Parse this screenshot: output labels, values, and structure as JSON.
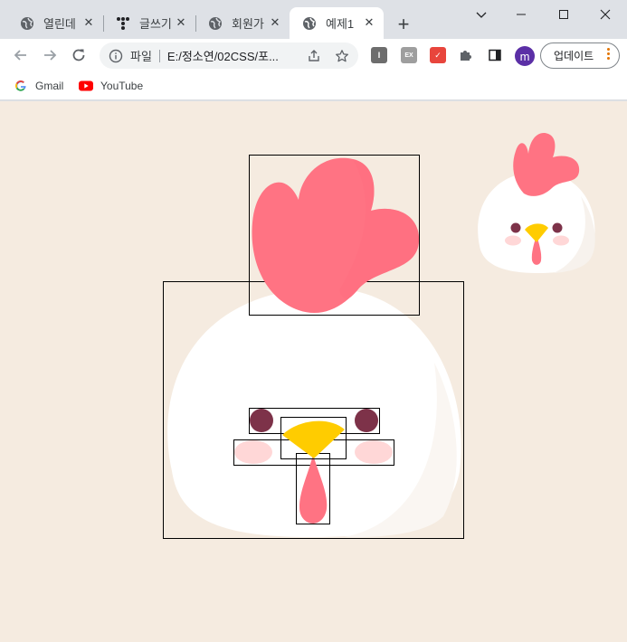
{
  "tabs": [
    {
      "title": "열린데",
      "icon": "globe-icon",
      "active": false
    },
    {
      "title": "글쓰기",
      "icon": "tistory-icon",
      "active": false
    },
    {
      "title": "회원가",
      "icon": "globe-icon",
      "active": false
    },
    {
      "title": "예제1",
      "icon": "globe-icon",
      "active": true
    }
  ],
  "toolbar": {
    "address_label": "파일",
    "url": "E:/정소연/02CSS/포...",
    "avatar_letter": "m",
    "update_label": "업데이트"
  },
  "bookmarks": [
    {
      "label": "Gmail",
      "icon": "google-icon"
    },
    {
      "label": "YouTube",
      "icon": "youtube-icon"
    }
  ],
  "extensions": [
    {
      "name": "ext-i-icon",
      "letter": "I",
      "color": "#6d6d6d"
    },
    {
      "name": "ext-ex-icon",
      "letter": "EX",
      "color": "#9e9e9e"
    },
    {
      "name": "ext-calendar-icon",
      "letter": "✓",
      "color": "#e8453c"
    }
  ],
  "colors": {
    "page_bg": "#f5ebe0",
    "body": "#ffffff",
    "comb": "#ff7383",
    "eye": "#7d3249",
    "beak": "#ffcc00",
    "cheek": "#ffd7d7",
    "wattle": "#ff7383"
  }
}
